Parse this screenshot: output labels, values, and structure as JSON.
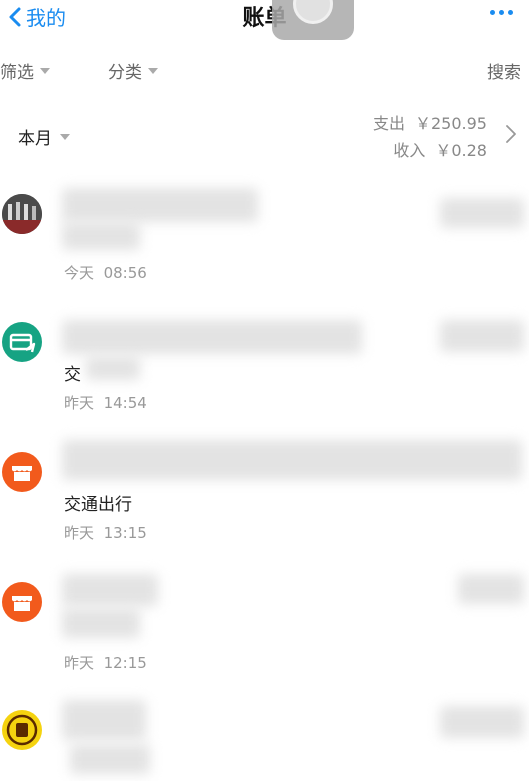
{
  "nav": {
    "back_label": "我的",
    "title": "账单"
  },
  "filters": {
    "filter_label": "筛选",
    "category_label": "分类",
    "search_label": "搜索"
  },
  "summary": {
    "month_label": "本月",
    "expense_label": "支出",
    "expense_value": "￥250.95",
    "income_label": "收入",
    "income_value": "￥0.28"
  },
  "transactions": [
    {
      "merchant": "",
      "date": "今天",
      "time": "08:56",
      "icon": "photo-avatar",
      "color": "#3a3a3a"
    },
    {
      "merchant": "交",
      "date": "昨天",
      "time": "14:54",
      "icon": "transfer-card-icon",
      "color": "#16a383"
    },
    {
      "merchant": "交通出行",
      "date": "昨天",
      "time": "13:15",
      "icon": "shop-icon",
      "color": "#f25a1c"
    },
    {
      "merchant": "",
      "date": "昨天",
      "time": "12:15",
      "icon": "shop-icon",
      "color": "#f25a1c"
    },
    {
      "merchant": "",
      "date": "",
      "time": "",
      "icon": "brand-logo-icon",
      "color": "#f5d30f"
    }
  ],
  "colors": {
    "accent": "#1a8cf0",
    "muted_text": "#999999"
  }
}
